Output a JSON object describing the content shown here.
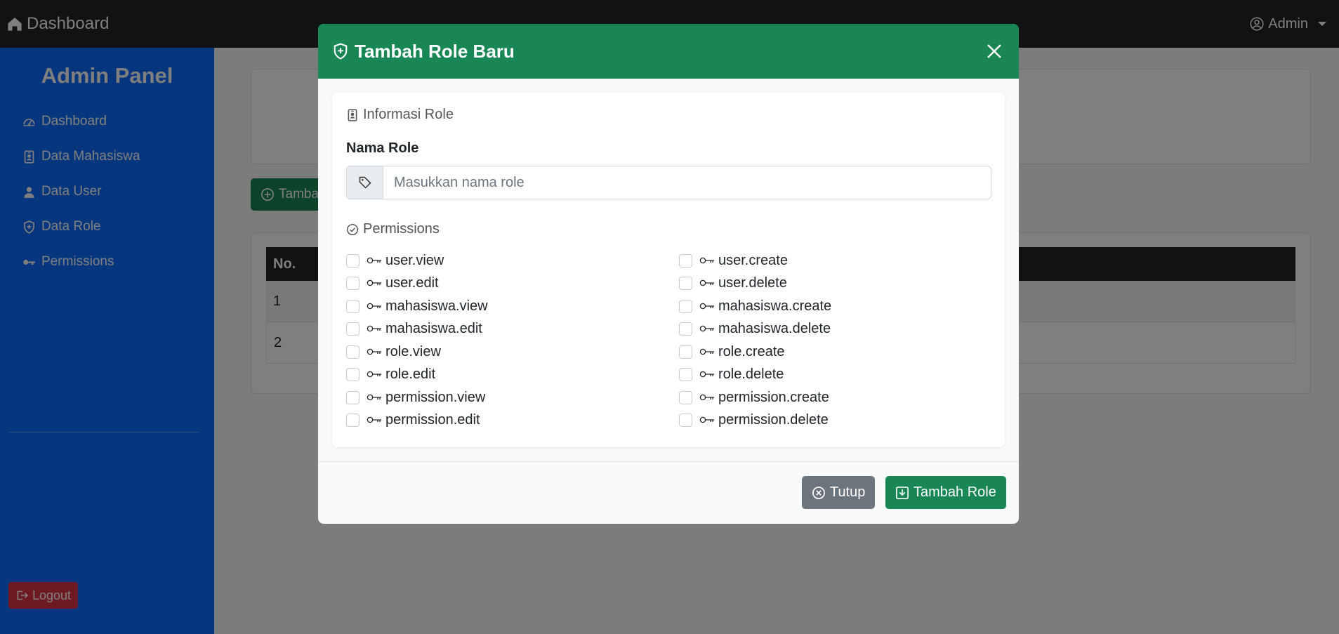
{
  "navbar": {
    "brand": "Dashboard",
    "user": "Admin"
  },
  "sidebar": {
    "title": "Admin Panel",
    "items": [
      {
        "label": "Dashboard",
        "icon": "speedometer-icon"
      },
      {
        "label": "Data Mahasiswa",
        "icon": "person-badge-icon"
      },
      {
        "label": "Data User",
        "icon": "person-icon"
      },
      {
        "label": "Data Role",
        "icon": "shield-icon"
      },
      {
        "label": "Permissions",
        "icon": "key-icon"
      }
    ],
    "logout": "Logout"
  },
  "background": {
    "add_button": "Tamba",
    "table_header_no": "No.",
    "rows": [
      "1",
      "2"
    ]
  },
  "modal": {
    "title": "Tambah Role Baru",
    "info_section": "Informasi Role",
    "role_label": "Nama Role",
    "role_placeholder": "Masukkan nama role",
    "permissions_section": "Permissions",
    "permissions": [
      {
        "name": "user.view",
        "checked": false
      },
      {
        "name": "user.create",
        "checked": false
      },
      {
        "name": "user.edit",
        "checked": false
      },
      {
        "name": "user.delete",
        "checked": false
      },
      {
        "name": "mahasiswa.view",
        "checked": false
      },
      {
        "name": "mahasiswa.create",
        "checked": false
      },
      {
        "name": "mahasiswa.edit",
        "checked": false
      },
      {
        "name": "mahasiswa.delete",
        "checked": false
      },
      {
        "name": "role.view",
        "checked": false
      },
      {
        "name": "role.create",
        "checked": false
      },
      {
        "name": "role.edit",
        "checked": false
      },
      {
        "name": "role.delete",
        "checked": false
      },
      {
        "name": "permission.view",
        "checked": false
      },
      {
        "name": "permission.create",
        "checked": false
      },
      {
        "name": "permission.edit",
        "checked": false
      },
      {
        "name": "permission.delete",
        "checked": false
      }
    ],
    "close_button": "Tutup",
    "submit_button": "Tambah Role"
  },
  "colors": {
    "navbar": "#212529",
    "sidebar": "#0d6efd",
    "success": "#198754",
    "secondary": "#6c757d",
    "danger": "#dc3545"
  }
}
